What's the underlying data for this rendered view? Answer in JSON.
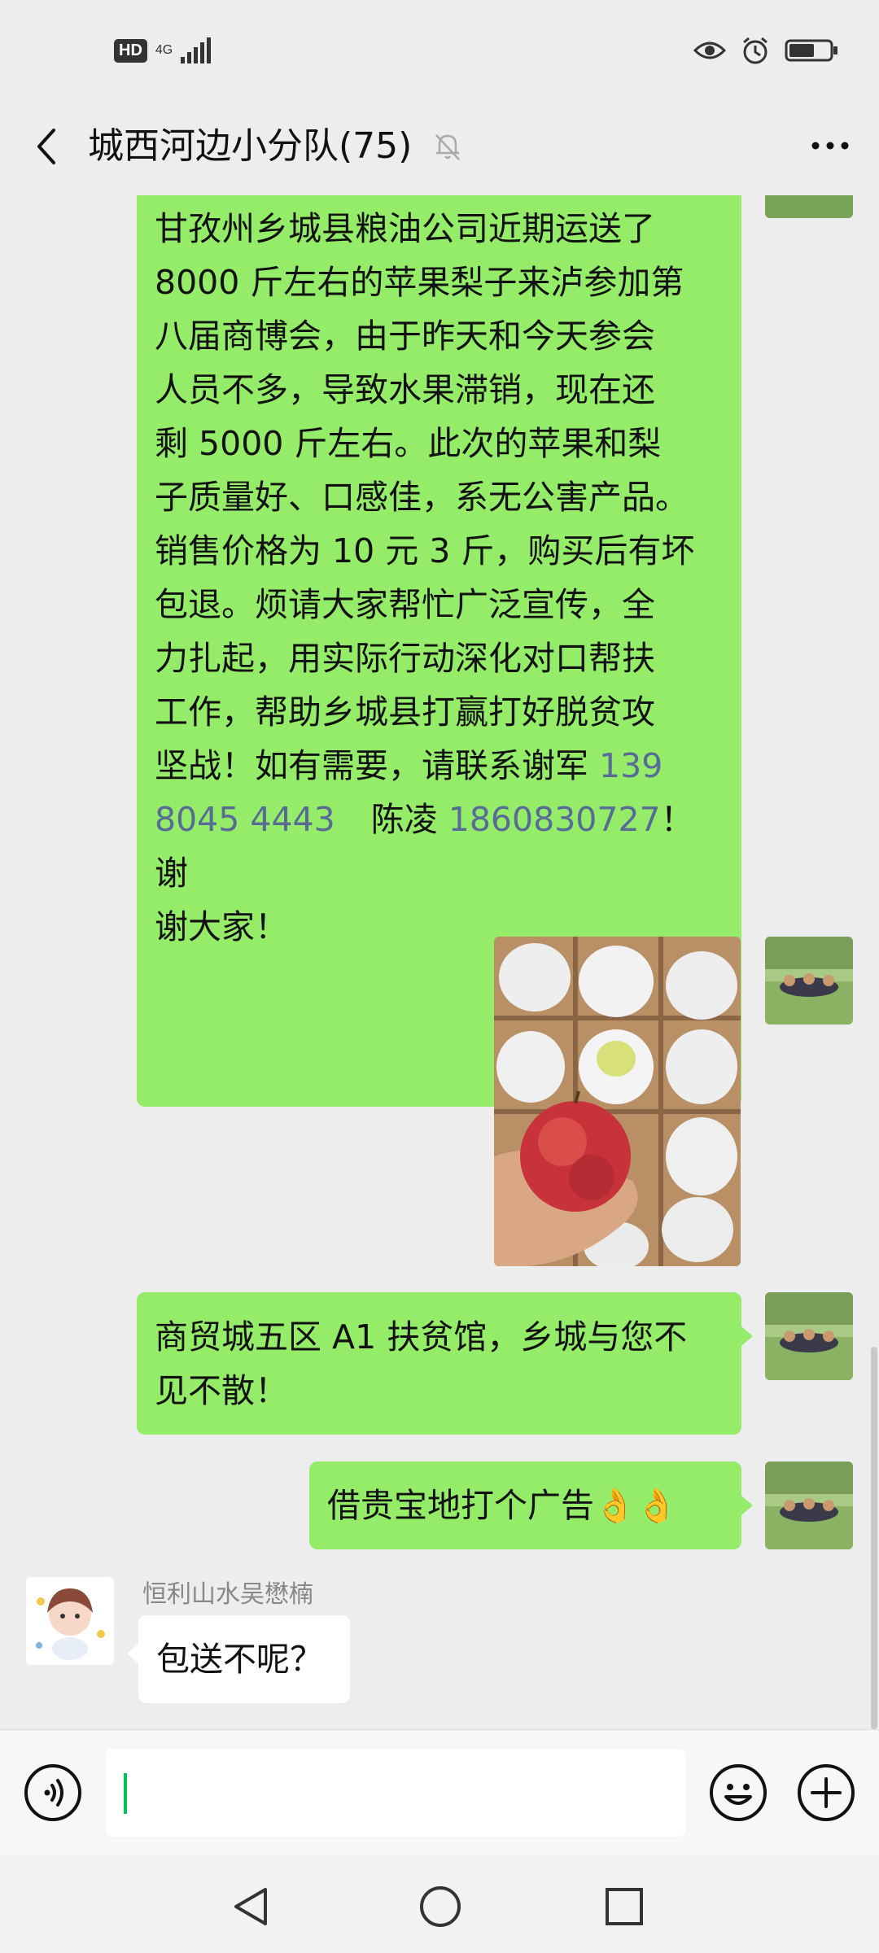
{
  "status_bar": {
    "hd": "HD",
    "network": "4G"
  },
  "header": {
    "title": "城西河边小分队(75)"
  },
  "messages": {
    "m1": {
      "l1": "甘孜州乡城县粮油公司近期运送了",
      "l2": "8000 斤左右的苹果梨子来泸参加第",
      "l3": "八届商博会，由于昨天和今天参会",
      "l4": "人员不多，导致水果滞销，现在还",
      "l5": "剩 5000 斤左右。此次的苹果和梨",
      "l6": "子质量好、口感佳，系无公害产品。",
      "l7": "销售价格为 10 元 3 斤，购买后有坏",
      "l8": "包退。烦请大家帮忙广泛宣传，全",
      "l9": "力扎起，用实际行动深化对口帮扶",
      "l10": "工作，帮助乡城县打赢打好脱贫攻",
      "l11a": "坚战！如有需要，请联系谢军 ",
      "phone1a": "139",
      "phone1b": "8045 4443",
      "l12mid": "陈凌 ",
      "phone2": "1860830727",
      "l12end": "！谢",
      "l13": "谢大家！"
    },
    "m3": {
      "l1": "商贸城五区 A1 扶贫馆，乡城与您不",
      "l2": "见不散！"
    },
    "m4": {
      "text": "借贵宝地打个广告",
      "emoji": "👌👌"
    },
    "m5": {
      "sender": "恒利山水吴懋楠",
      "text": "包送不呢？"
    }
  }
}
